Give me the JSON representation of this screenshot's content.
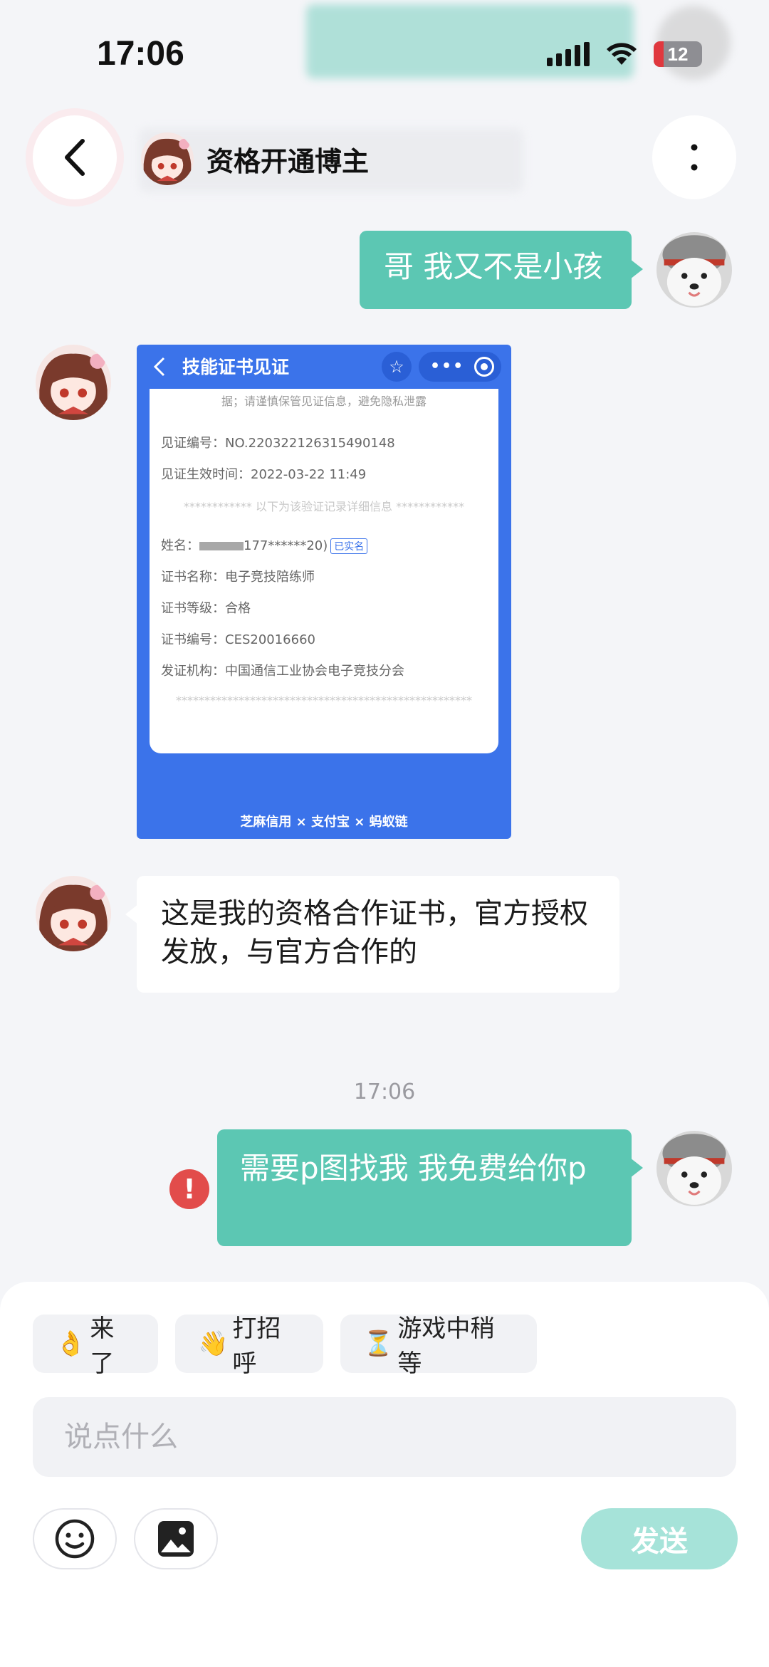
{
  "status_bar": {
    "time": "17:06",
    "battery": "12"
  },
  "header": {
    "title": "资格开通博主"
  },
  "messages": {
    "me_1": "哥 我又不是小孩",
    "other_text": "这是我的资格合作证书，官方授权发放，与官方合作的",
    "timestamp": "17:06",
    "me_2": "需要p图找我 我免费给你p"
  },
  "certificate": {
    "title": "技能证书见证",
    "notice": "据；请谨慎保管见证信息，避免隐私泄露",
    "witness_no": "见证编号：NO.220322126315490148",
    "effective_time": "见证生效时间：2022-03-22 11:49",
    "divider": "************ 以下为该验证记录详细信息 ************",
    "name_label": "姓名：",
    "name_value": "177******20)",
    "verified": "已实名",
    "cert_name": "证书名称：电子竞技陪练师",
    "cert_level": "证书等级：合格",
    "cert_no": "证书编号：CES20016660",
    "issuer": "发证机构：中国通信工业协会电子竞技分会",
    "stars": "****************************************************",
    "footer": "芝麻信用 × 支付宝 × 蚂蚁链"
  },
  "quick_replies": [
    {
      "emoji": "👌",
      "label": "来了"
    },
    {
      "emoji": "👋",
      "label": "打招呼"
    },
    {
      "emoji": "⏳",
      "label": "游戏中稍等"
    }
  ],
  "input": {
    "placeholder": "说点什么"
  },
  "send_label": "发送",
  "colors": {
    "accent": "#5cc7b3",
    "send_disabled": "#a6e3d9",
    "error": "#e24c4b",
    "cert_blue": "#3b73ea"
  },
  "icons": [
    "back-icon",
    "more-icon",
    "emoji-icon",
    "image-icon",
    "error-icon",
    "star-icon"
  ]
}
